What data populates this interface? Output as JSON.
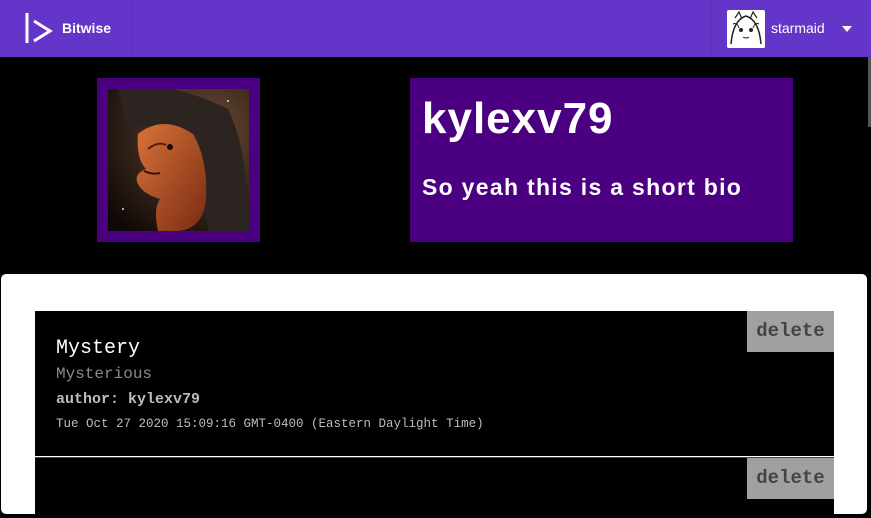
{
  "navbar": {
    "brand": "Bitwise",
    "user": "starmaid"
  },
  "profile": {
    "username": "kylexv79",
    "bio": "So yeah this is a short bio"
  },
  "posts": [
    {
      "title": "Mystery",
      "subtitle": "Mysterious",
      "author": "author: kylexv79",
      "date": "Tue Oct 27 2020 15:09:16 GMT-0400 (Eastern Daylight Time)",
      "delete_label": "delete"
    },
    {
      "title": "",
      "delete_label": "delete"
    }
  ],
  "colors": {
    "navbar": "#6435c9",
    "profile_box": "#4b0082",
    "post_bg": "#000000",
    "delete_bg": "#a0a0a0"
  }
}
